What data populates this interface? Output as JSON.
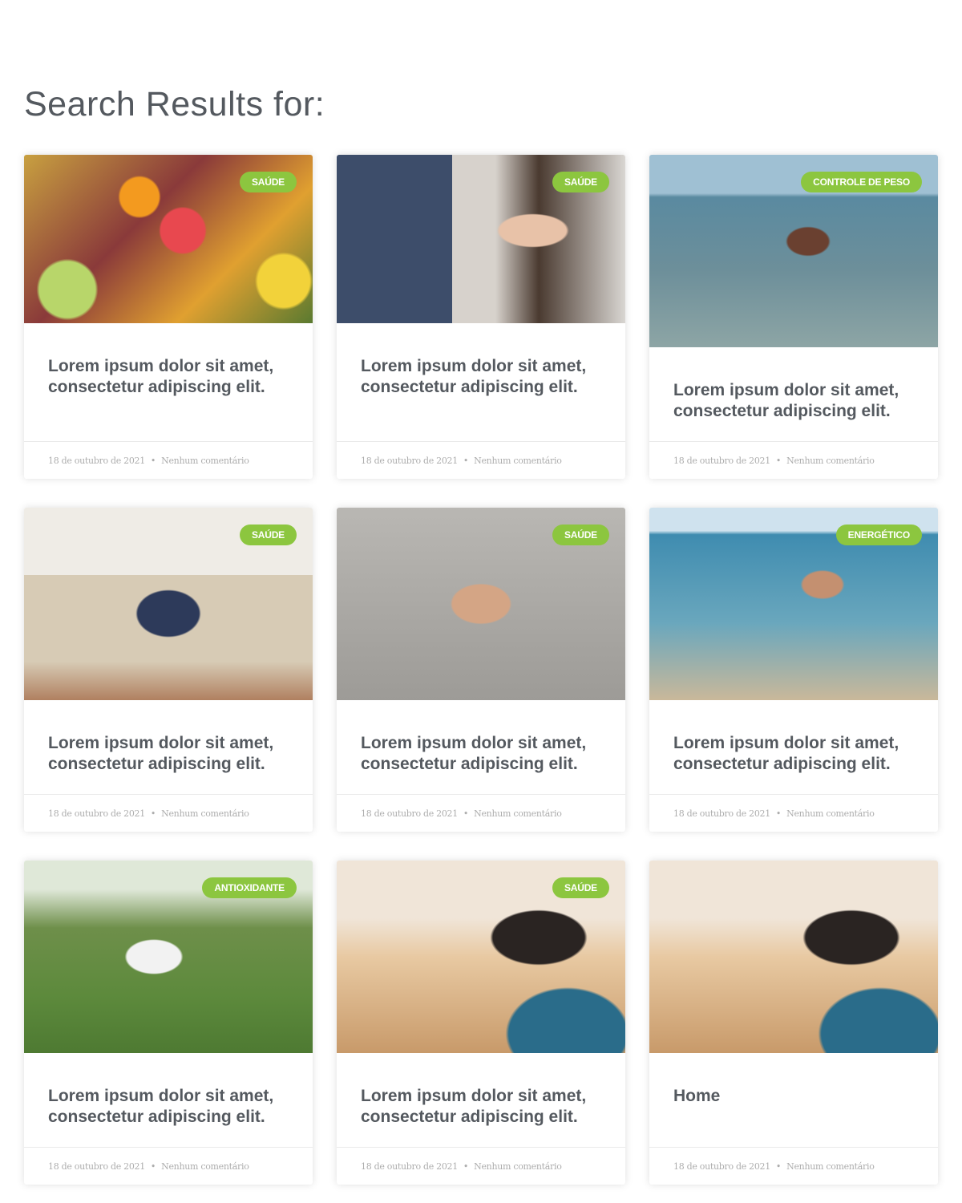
{
  "heading": "Search Results for:",
  "posts": [
    {
      "category": "SAÚDE",
      "title": "Lorem ipsum dolor sit amet, consectetur adipiscing elit.",
      "date": "18 de outubro de 2021",
      "comments": "Nenhum comentário",
      "image": "fruit-platter"
    },
    {
      "category": "SAÚDE",
      "title": "Lorem ipsum dolor sit amet, consectetur adipiscing elit.",
      "date": "18 de outubro de 2021",
      "comments": "Nenhum comentário",
      "image": "girl-drinking-on-sofa"
    },
    {
      "category": "CONTROLE DE PESO",
      "title": "Lorem ipsum dolor sit amet, consectetur adipiscing elit.",
      "date": "18 de outubro de 2021",
      "comments": "Nenhum comentário",
      "image": "woman-running-beach"
    },
    {
      "category": "SAÚDE",
      "title": "Lorem ipsum dolor sit amet, consectetur adipiscing elit.",
      "date": "18 de outubro de 2021",
      "comments": "Nenhum comentário",
      "image": "family-on-sofa"
    },
    {
      "category": "SAÚDE",
      "title": "Lorem ipsum dolor sit amet, consectetur adipiscing elit.",
      "date": "18 de outubro de 2021",
      "comments": "Nenhum comentário",
      "image": "woman-stretching"
    },
    {
      "category": "ENERGÉTICO",
      "title": "Lorem ipsum dolor sit amet, consectetur adipiscing elit.",
      "date": "18 de outubro de 2021",
      "comments": "Nenhum comentário",
      "image": "woman-kicking-water"
    },
    {
      "category": "ANTIOXIDANTE",
      "title": "Lorem ipsum dolor sit amet, consectetur adipiscing elit.",
      "date": "18 de outubro de 2021",
      "comments": "Nenhum comentário",
      "image": "man-stretching-park"
    },
    {
      "category": "SAÚDE",
      "title": "Lorem ipsum dolor sit amet, consectetur adipiscing elit.",
      "date": "18 de outubro de 2021",
      "comments": "Nenhum comentário",
      "image": "woman-water-bottle-sunset"
    },
    {
      "category": null,
      "title": "Home",
      "date": "18 de outubro de 2021",
      "comments": "Nenhum comentário",
      "image": "woman-water-bottle-sunset"
    }
  ],
  "meta_separator": "•",
  "colors": {
    "badge": "#8cc63f",
    "title": "#54595f",
    "meta": "#adadad"
  }
}
